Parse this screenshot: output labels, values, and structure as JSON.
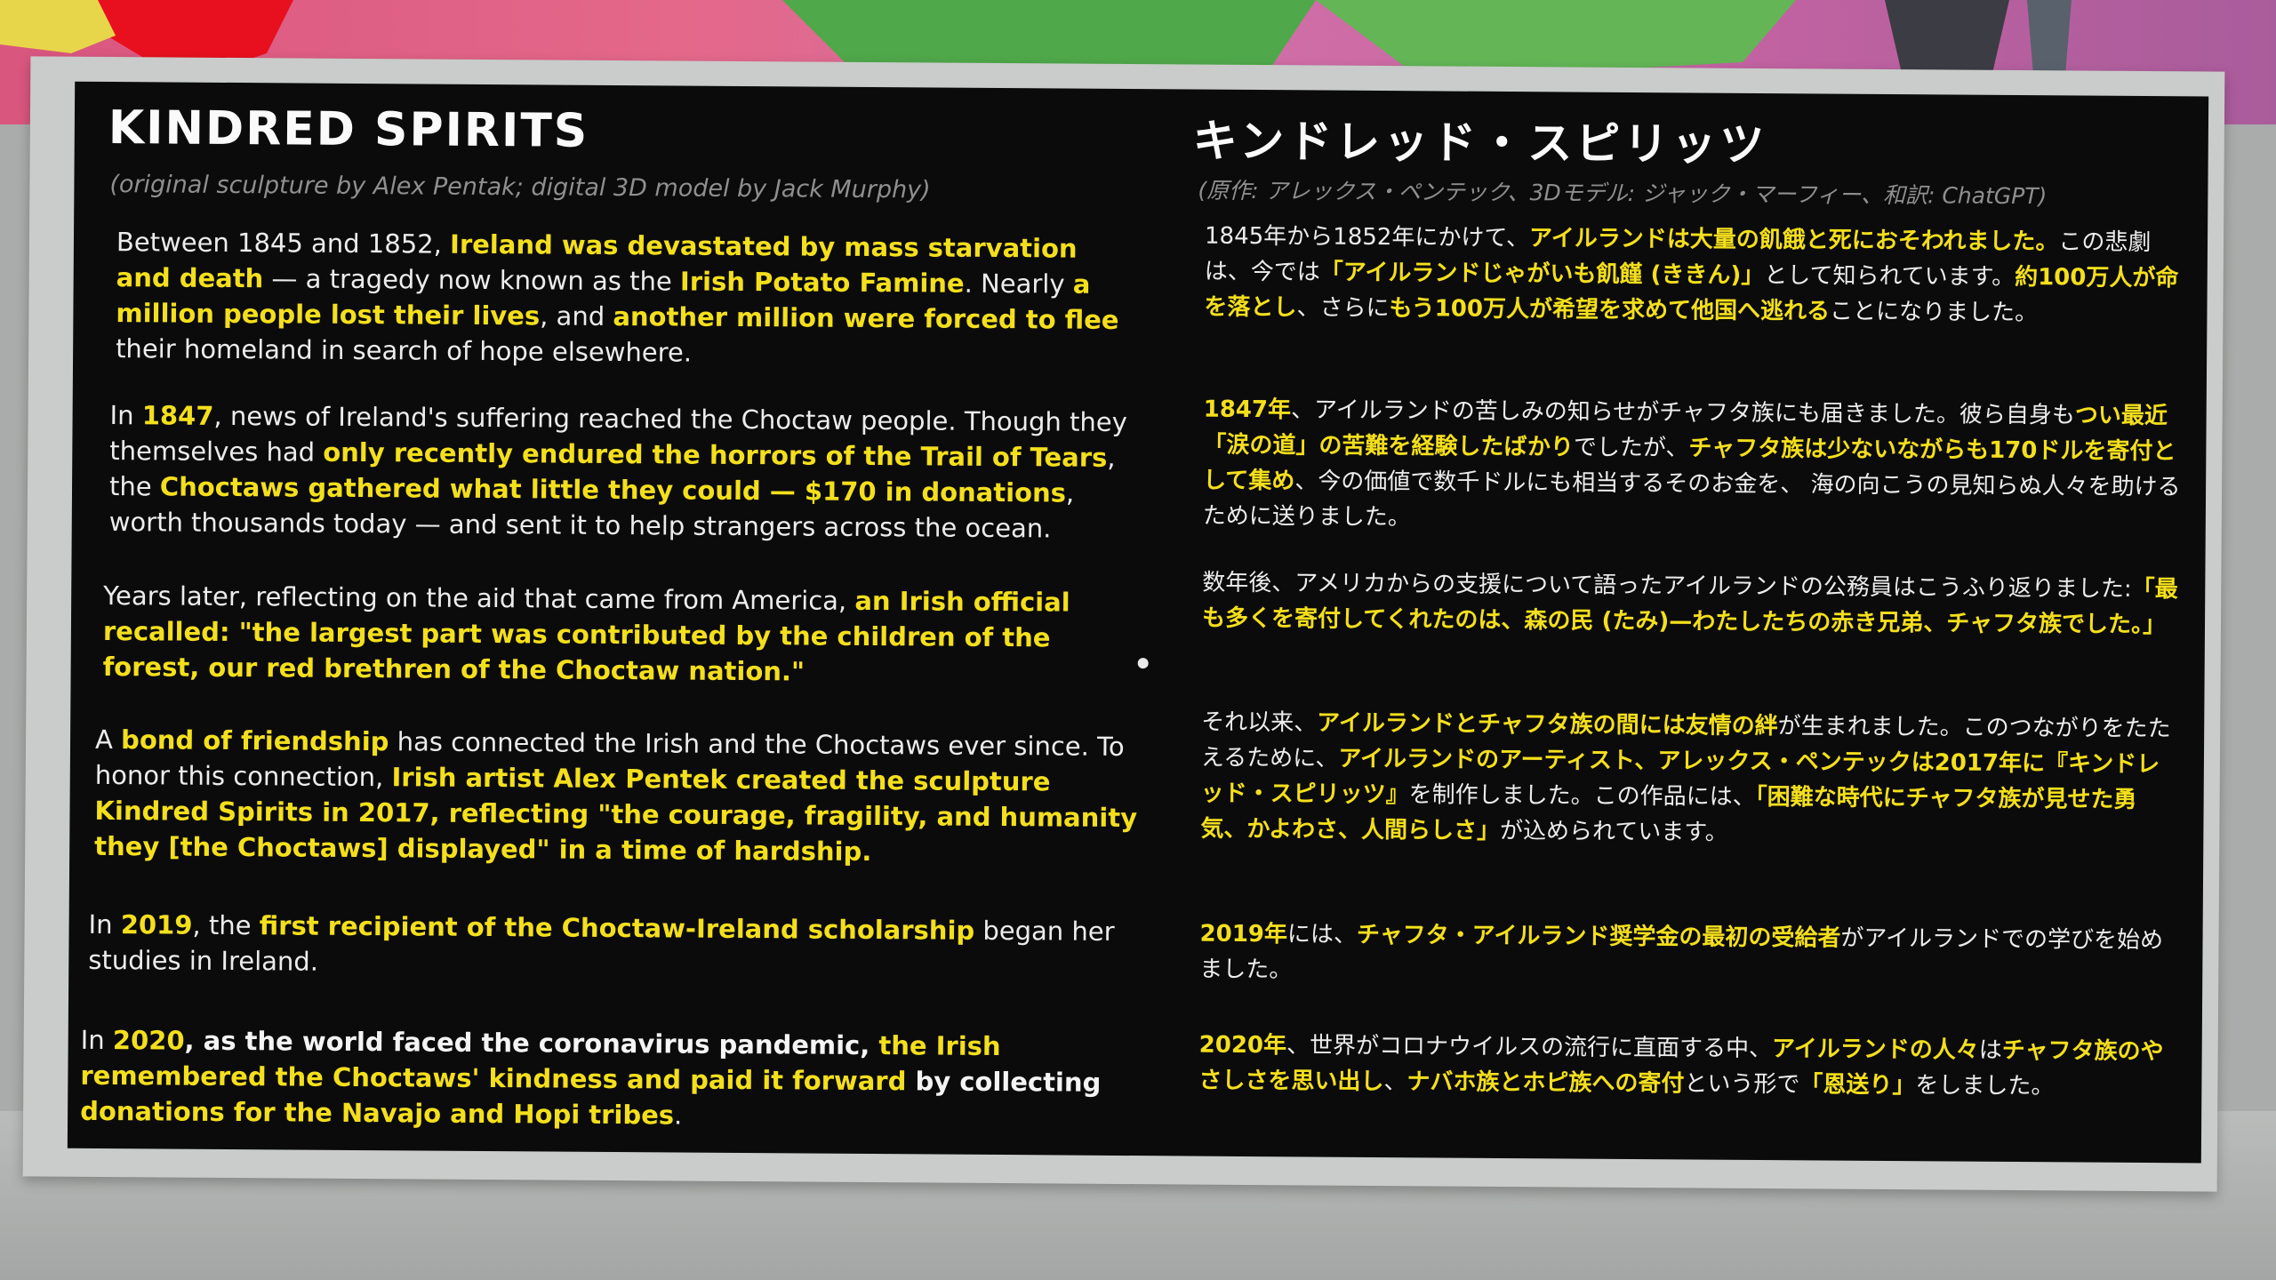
{
  "sign": {
    "title_en": "KINDRED SPIRITS",
    "credit_en": "(original sculpture by Alex Pentak; digital 3D model by Jack Murphy)",
    "title_ja": "キンドレッド・スピリッツ",
    "credit_ja": "(原作: アレックス・ペンテック、3Dモデル: ジャック・マーフィー、和訳: ChatGPT)",
    "en": {
      "p1": {
        "a": "Between 1845 and 1852, ",
        "b": "Ireland was devastated by mass starvation and death",
        "c": " — a tragedy now known as the ",
        "d": "Irish Potato Famine",
        "e": ". Nearly ",
        "f": "a million people lost their lives",
        "g": ", and ",
        "h": "another million were forced to flee",
        "i": " their homeland in search of hope elsewhere."
      },
      "p2": {
        "a": "In ",
        "b": "1847",
        "c": ", news of Ireland's suffering reached the Choctaw people. Though they themselves had ",
        "d": "only recently endured the horrors of the Trail of Tears",
        "e": ", the ",
        "f": "Choctaws gathered what little they could — $170 in donations",
        "g": ", worth thousands today — and sent it to help strangers across the ocean."
      },
      "p3": {
        "a": "Years later, reflecting on the aid that came from America, ",
        "b": "an Irish official recalled: \"the largest part was contributed by the children of the forest, our red brethren of the Choctaw nation.\""
      },
      "p4": {
        "a": "A ",
        "b": "bond of friendship",
        "c": " has connected the Irish and the Choctaws ever since. To honor this connection, ",
        "d": "Irish artist Alex Pentek created the sculpture Kindred Spirits in 2017, reflecting \"the courage, fragility, and humanity they [the Choctaws] displayed\" in a time of hardship."
      },
      "p5": {
        "a": "In ",
        "b": "2019",
        "c": ", the ",
        "d": "first recipient of the Choctaw-Ireland scholarship",
        "e": " began her studies in Ireland."
      },
      "p6": {
        "a": "In ",
        "b": "2020",
        "c": ", as the world faced the coronavirus pandemic, ",
        "d": "the Irish remembered the Choctaws' kindness and paid it forward",
        "e": " by collecting ",
        "f": "donations for the Navajo and Hopi tribes",
        "g": "."
      }
    },
    "ja": {
      "p1": {
        "a": "1845年から1852年にかけて、",
        "b": "アイルランドは大量の飢餓と死におそわれました。",
        "c": "この悲劇は、今では",
        "d": "「アイルランドじゃがいも飢饉 (ききん)」",
        "e": "として知られています。",
        "f": "約100万人が命を落とし",
        "g": "、さらに",
        "h": "もう100万人が希望を求めて他国へ逃れる",
        "i": "ことになりました。"
      },
      "p2": {
        "a": "1847年",
        "b": "、アイルランドの苦しみの知らせがチャフタ族にも届きました。彼ら自身も",
        "c": "つい最近「涙の道」の苦難を経験したばかり",
        "d": "でしたが、",
        "e": "チャフタ族は少ないながらも170ドルを寄付として集め",
        "f": "、今の価値で数千ドルにも相当するそのお金を、 海の向こうの見知らぬ人々を助けるために送りました。"
      },
      "p3": {
        "a": "数年後、アメリカからの支援について語ったアイルランドの公務員はこうふり返りました:",
        "b": "「最も多くを寄付してくれたのは、森の民 (たみ)—わたしたちの赤き兄弟、チャフタ族でした。」"
      },
      "p4": {
        "a": "それ以来、",
        "b": "アイルランドとチャフタ族の間には友情の絆",
        "c": "が生まれました。このつながりをたたえるために、",
        "d": "アイルランドのアーティスト、アレックス・ペンテックは2017年に『キンドレッド・スピリッツ』",
        "e": "を制作しました。この作品には、",
        "f": "「困難な時代にチャフタ族が見せた勇気、かよわさ、人間らしさ」",
        "g": "が込められています。"
      },
      "p5": {
        "a": "2019年",
        "b": "には、",
        "c": "チャフタ・アイルランド奨学金の最初の受給者",
        "d": "がアイルランドでの学びを始めました。"
      },
      "p6": {
        "a": "2020年",
        "b": "、世界がコロナウイルスの流行に直面する中、",
        "c": "アイルランドの人々",
        "d": "は",
        "e": "チャフタ族のやさしさを思い出し",
        "f": "、",
        "g": "ナバホ族とホピ族への寄付",
        "h": "という形で",
        "i": "「恩送り」",
        "j": "をしました。"
      }
    }
  },
  "colors": {
    "highlight": "#f4df1c",
    "board": "#0b0b0b",
    "frame": "#c9ccca",
    "sky_pink": "#d9567f"
  }
}
